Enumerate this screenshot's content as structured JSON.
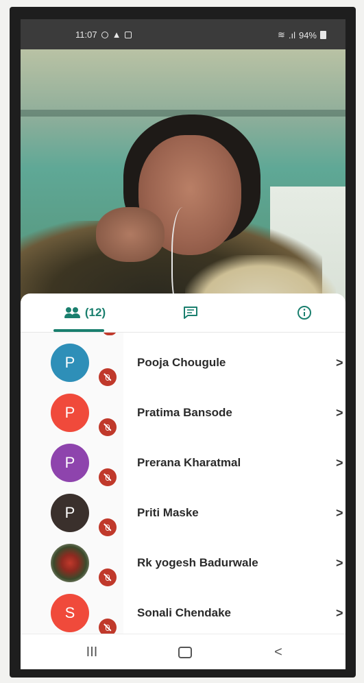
{
  "status_bar": {
    "time": "11:07",
    "battery": "94%",
    "icons": [
      "whatsapp-icon",
      "drive-icon",
      "gallery-icon",
      "wifi-icon",
      "signal-icon",
      "battery-icon"
    ]
  },
  "tabs": {
    "participants_count": "(12)",
    "participants_icon": "people-icon",
    "chat_icon": "chat-icon",
    "info_icon": "info-icon"
  },
  "participants": [
    {
      "initial": "P",
      "name": "Pooja Chougule",
      "avatar_color": "#2e8fb8"
    },
    {
      "initial": "P",
      "name": "Pratima Bansode",
      "avatar_color": "#f04a3b"
    },
    {
      "initial": "P",
      "name": "Prerana Kharatmal",
      "avatar_color": "#8e44ad"
    },
    {
      "initial": "P",
      "name": "Priti Maske",
      "avatar_color": "#3a302c"
    },
    {
      "initial": "",
      "name": "Rk yogesh Badurwale",
      "avatar_color": "photo"
    },
    {
      "initial": "S",
      "name": "Sonali Chendake",
      "avatar_color": "#f04a3b"
    }
  ],
  "chevron": ">",
  "nav": {
    "recents": "III",
    "back": "<"
  },
  "colors": {
    "accent": "#1a7f6e",
    "muted_badge": "#c0392b"
  }
}
